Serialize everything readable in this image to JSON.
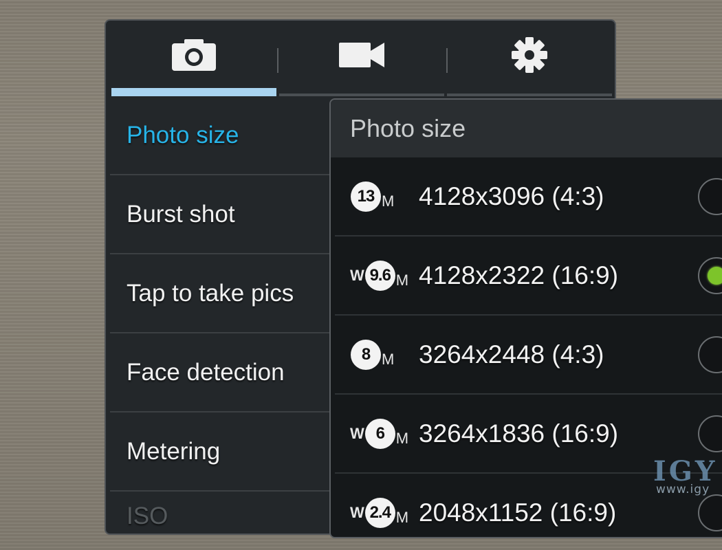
{
  "tabs": [
    {
      "icon": "camera-icon",
      "active": true
    },
    {
      "icon": "video-camera-icon",
      "active": false
    },
    {
      "icon": "gear-icon",
      "active": false
    }
  ],
  "menu": {
    "items": [
      {
        "label": "Photo size",
        "active": true
      },
      {
        "label": "Burst shot"
      },
      {
        "label": "Tap to take pics"
      },
      {
        "label": "Face detection"
      },
      {
        "label": "Metering"
      },
      {
        "label": "ISO"
      }
    ]
  },
  "dialog": {
    "title": "Photo size",
    "options": [
      {
        "wide": "",
        "mp": "13",
        "unit": "M",
        "label": "4128x3096 (4:3)",
        "selected": false
      },
      {
        "wide": "W",
        "mp": "9.6",
        "unit": "M",
        "label": "4128x2322 (16:9)",
        "selected": true
      },
      {
        "wide": "",
        "mp": "8",
        "unit": "M",
        "label": "3264x2448 (4:3)",
        "selected": false
      },
      {
        "wide": "W",
        "mp": "6",
        "unit": "M",
        "label": "3264x1836 (16:9)",
        "selected": false
      },
      {
        "wide": "W",
        "mp": "2.4",
        "unit": "M",
        "label": "2048x1152 (16:9)",
        "selected": false
      }
    ]
  },
  "watermark": {
    "text": "IGY",
    "url": "www.igy"
  },
  "colors": {
    "accent_text": "#27b4e8",
    "tab_active": "#a9d4f0",
    "radio_selected": "#7dc42a"
  }
}
